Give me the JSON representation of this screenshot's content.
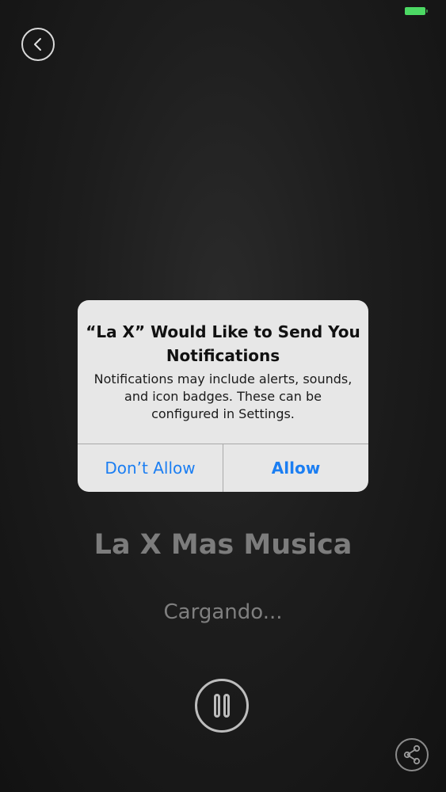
{
  "status_bar": {
    "battery_color": "#4cd964"
  },
  "nav": {
    "back_icon": "chevron-left-icon"
  },
  "player": {
    "station_title": "La X Mas Musica",
    "status_text": "Cargando...",
    "pause_icon": "pause-icon",
    "share_icon": "share-icon"
  },
  "alert": {
    "title": "“La X” Would Like to Send You Notifications",
    "message": "Notifications may include alerts, sounds, and icon badges. These can be configured in Settings.",
    "dont_allow_label": "Don’t Allow",
    "allow_label": "Allow",
    "accent_color": "#1b7ef2"
  }
}
